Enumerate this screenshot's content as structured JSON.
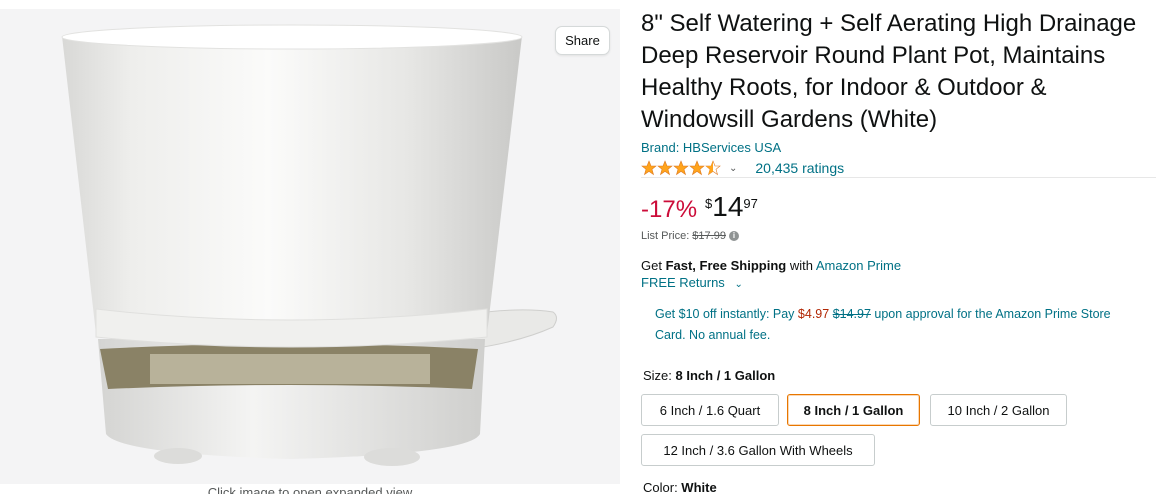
{
  "gallery": {
    "share_label": "Share",
    "caption": "Click image to open expanded view"
  },
  "product": {
    "title": "8\" Self Watering + Self Aerating High Drainage Deep Reservoir Round Plant Pot, Maintains Healthy Roots, for Indoor & Outdoor & Windowsill Gardens (White)",
    "brand": "Brand: HBServices USA",
    "rating_stars": 4.5,
    "rating_count": "20,435 ratings"
  },
  "pricing": {
    "discount": "-17%",
    "currency_symbol": "$",
    "price_whole": "14",
    "price_fraction": "97",
    "list_price_label": "List Price:",
    "list_price": "$17.99"
  },
  "shipping": {
    "prefix": "Get ",
    "bold": "Fast, Free Shipping",
    "middle": " with ",
    "prime_link": "Amazon Prime",
    "returns": "FREE Returns"
  },
  "promo": {
    "part1": "Get $10 off instantly: Pay ",
    "pay_price": "$4.97",
    "orig_price": "$14.97",
    "part2": " upon approval for the Amazon Prime Store Card. No annual fee."
  },
  "size": {
    "label": "Size: ",
    "selected": "8 Inch / 1 Gallon",
    "options": [
      "6 Inch / 1.6 Quart",
      "8 Inch / 1 Gallon",
      "10 Inch / 2 Gallon",
      "12 Inch / 3.6 Gallon With Wheels"
    ]
  },
  "color": {
    "label": "Color: ",
    "selected": "White"
  },
  "colors": {
    "link": "#007185",
    "discount": "#cc0c39",
    "star": "#ffa41c",
    "selected_border": "#e77600"
  }
}
